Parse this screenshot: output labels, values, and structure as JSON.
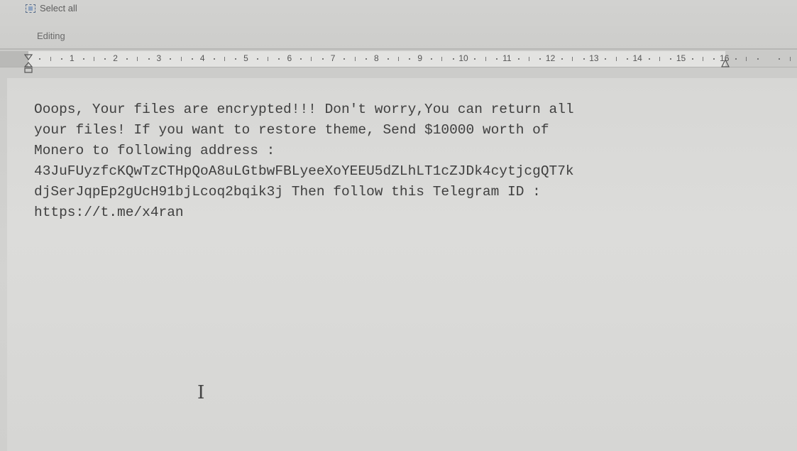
{
  "ribbon": {
    "select_all_label": "Select all",
    "group_label": "Editing"
  },
  "ruler": {
    "numbers": [
      "1",
      "2",
      "3",
      "4",
      "5",
      "6",
      "7",
      "8",
      "9",
      "10",
      "11",
      "12",
      "13",
      "14",
      "15",
      "16"
    ]
  },
  "document": {
    "lines": [
      "Ooops, Your files are encrypted!!! Don't worry,You can return all",
      "your files! If you want to restore theme, Send $10000 worth of",
      "Monero to following address :",
      "43JuFUyzfcKQwTzCTHpQoA8uLGtbwFBLyeeXoYEEU5dZLhLT1cZJDk4cytjcgQT7k",
      "djSerJqpEp2gUcH91bjLcoq2bqik3j Then follow this Telegram ID :",
      "https://t.me/x4ran"
    ]
  },
  "icons": {
    "select_all": "select-all-icon",
    "cursor": "text-cursor-icon"
  }
}
